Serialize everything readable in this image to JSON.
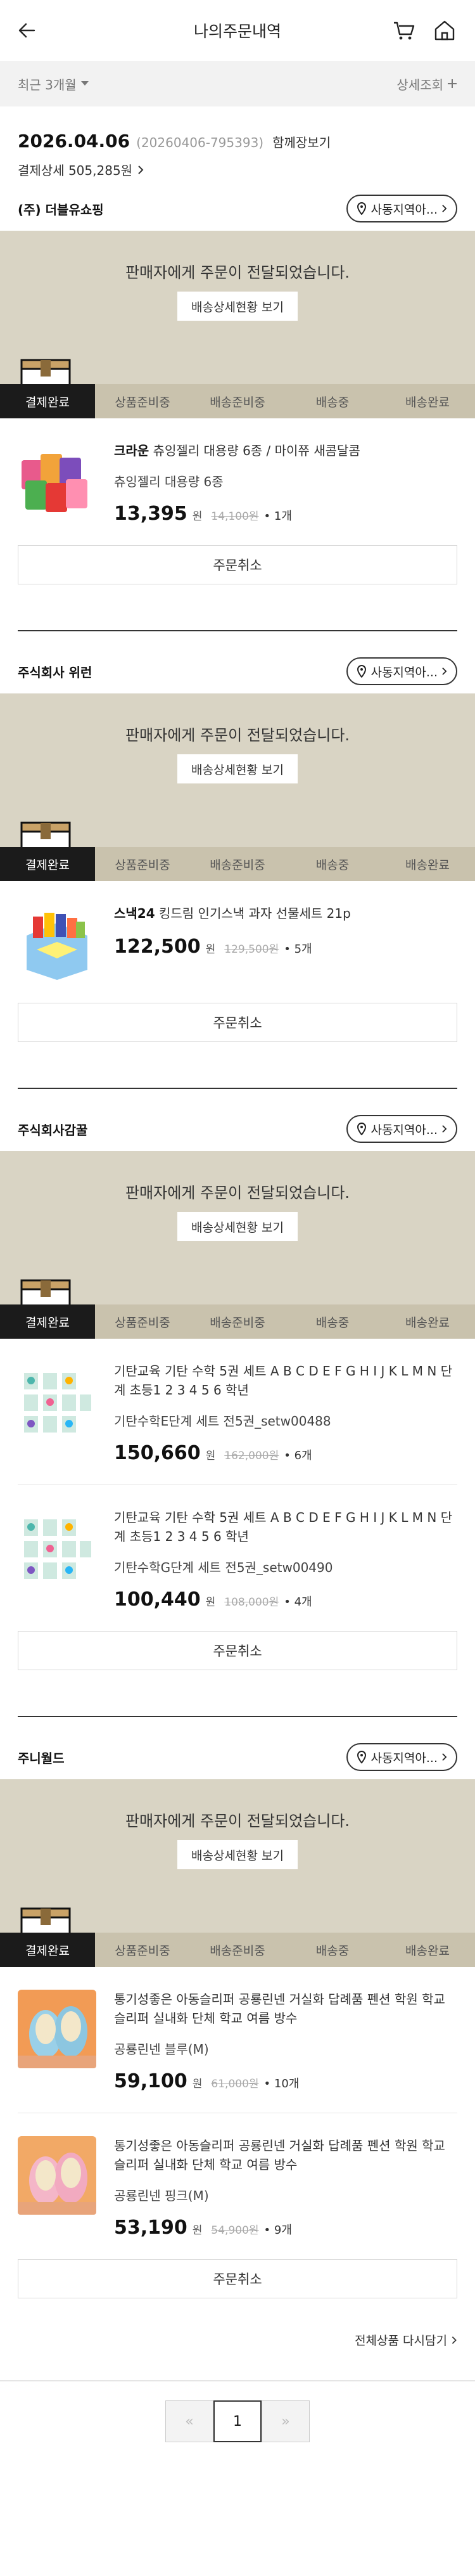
{
  "header": {
    "title": "나의주문내역"
  },
  "filter": {
    "period": "최근 3개월",
    "detail_search": "상세조회"
  },
  "order": {
    "date": "2026.04.06",
    "order_no": "(20260406-795393)",
    "bundle_view": "함께장보기",
    "payment": "결제상세 505,285원"
  },
  "common": {
    "banner_message": "판매자에게 주문이 전달되었습니다.",
    "tracking_label": "배송상세현황 보기",
    "address_label": "사동지역아...",
    "cancel_label": "주문취소",
    "won": "원",
    "steps": [
      "결제완료",
      "상품준비중",
      "배송준비중",
      "배송중",
      "배송완료"
    ]
  },
  "sellers": [
    {
      "name": "(주) 더블유쇼핑",
      "items": [
        {
          "brand": "크라운",
          "name": "크라운 츄잉젤리 대용량 6종 / 마이쮸 새콤달콤",
          "option": "츄잉젤리 대용량 6종",
          "price": "13,395",
          "orig_price": "14,100원",
          "qty": "• 1개"
        }
      ]
    },
    {
      "name": "주식회사 위런",
      "items": [
        {
          "brand": "스낵24",
          "name": "스낵24 킹드림 인기스낵 과자 선물세트 21p",
          "option": "",
          "price": "122,500",
          "orig_price": "129,500원",
          "qty": "• 5개"
        }
      ]
    },
    {
      "name": "주식회사감꿀",
      "items": [
        {
          "brand": "",
          "name": "기탄교육 기탄 수학 5권 세트 A B C D E F G H I J K L M N 단계 초등1 2 3 4 5 6 학년",
          "option": "기탄수학E단계 세트 전5권_setw00488",
          "price": "150,660",
          "orig_price": "162,000원",
          "qty": "• 6개"
        },
        {
          "brand": "",
          "name": "기탄교육 기탄 수학 5권 세트 A B C D E F G H I J K L M N 단계 초등1 2 3 4 5 6 학년",
          "option": "기탄수학G단계 세트 전5권_setw00490",
          "price": "100,440",
          "orig_price": "108,000원",
          "qty": "• 4개"
        }
      ]
    },
    {
      "name": "주니월드",
      "items": [
        {
          "brand": "",
          "name": "통기성좋은 아동슬리퍼 공룡린넨 거실화 답례품 펜션 학원 학교 슬리퍼 실내화 단체 학교 여름 방수",
          "option": "공룡린넨 블루(M)",
          "price": "59,100",
          "orig_price": "61,000원",
          "qty": "• 10개"
        },
        {
          "brand": "",
          "name": "통기성좋은 아동슬리퍼 공룡린넨 거실화 답례품 펜션 학원 학교 슬리퍼 실내화 단체 학교 여름 방수",
          "option": "공룡린넨 핑크(M)",
          "price": "53,190",
          "orig_price": "54,900원",
          "qty": "• 9개"
        }
      ]
    }
  ],
  "footer": {
    "reorder": "전체상품 다시담기",
    "pages": [
      "«",
      "1",
      "»"
    ]
  },
  "colors": {
    "banner": "#d9d4c4",
    "step_active": "#1b1b1b",
    "step_inactive": "#c9c2ad"
  }
}
